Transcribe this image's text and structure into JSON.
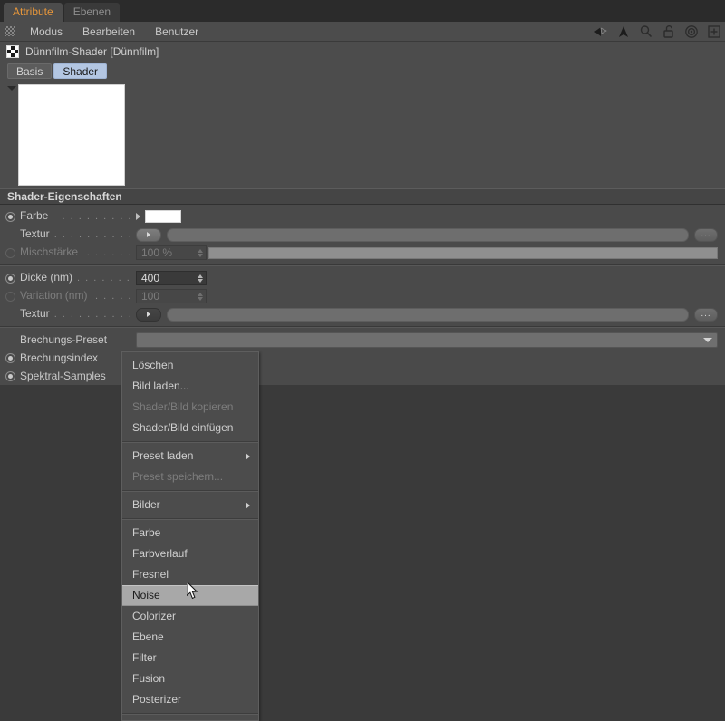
{
  "tabs": [
    {
      "label": "Attribute",
      "active": true
    },
    {
      "label": "Ebenen",
      "active": false
    }
  ],
  "menubar": {
    "grip_icon": "grip-dots-icon",
    "items": [
      "Modus",
      "Bearbeiten",
      "Benutzer"
    ],
    "tool_icons": [
      "back-arrow-icon",
      "up-arrow-icon",
      "search-icon",
      "unlock-icon",
      "target-icon",
      "plus-box-icon"
    ]
  },
  "object": {
    "icon": "checker-shader-icon",
    "title": "Dünnfilm-Shader [Dünnfilm]",
    "subtabs": [
      {
        "label": "Basis",
        "selected": false
      },
      {
        "label": "Shader",
        "selected": true
      }
    ]
  },
  "preview": {
    "collapse_icon": "triangle-down-icon",
    "swatch_color": "#ffffff"
  },
  "section": {
    "title": "Shader-Eigenschaften"
  },
  "properties": [
    {
      "name": "farbe",
      "label": "Farbe",
      "dots": ". . . . . . . . .",
      "radio": "on",
      "control": "color",
      "value": "#ffffff",
      "dim": false
    },
    {
      "name": "textur-farbe",
      "label": "Textur",
      "dots": ". . . . . . . . . . .",
      "radio": "none",
      "control": "texture",
      "value": "",
      "more_label": "...",
      "dim": false
    },
    {
      "name": "mischstaerke",
      "label": "Mischstärke",
      "dots": ". . . . . .",
      "radio": "off",
      "control": "slider",
      "value": "100 %",
      "dim": true
    },
    {
      "name": "dicke",
      "label": "Dicke (nm)",
      "dots": ". . . . . . . .",
      "radio": "on",
      "control": "number",
      "value": "400",
      "dim": false
    },
    {
      "name": "variation",
      "label": "Variation (nm)",
      "dots": ". . . . .",
      "radio": "off",
      "control": "number",
      "value": "100",
      "dim": true
    },
    {
      "name": "textur-dicke",
      "label": "Textur",
      "dots": ". . . . . . . . . . .",
      "radio": "none",
      "control": "texture",
      "value": "",
      "more_label": "...",
      "dim": false
    },
    {
      "name": "brechungs-preset",
      "label": "Brechungs-Preset",
      "dots": "",
      "radio": "none",
      "control": "dropdown",
      "value": "",
      "dim": false
    },
    {
      "name": "brechungsindex",
      "label": "Brechungsindex",
      "dots": "",
      "radio": "on",
      "control": "none",
      "value": "",
      "dim": false
    },
    {
      "name": "spektral-samples",
      "label": "Spektral-Samples",
      "dots": "",
      "radio": "on",
      "control": "none",
      "value": "",
      "dim": false
    }
  ],
  "context_menu": {
    "items": [
      {
        "label": "Löschen",
        "state": "normal",
        "submenu": false
      },
      {
        "label": "Bild laden...",
        "state": "normal",
        "submenu": false
      },
      {
        "label": "Shader/Bild kopieren",
        "state": "disabled",
        "submenu": false
      },
      {
        "label": "Shader/Bild einfügen",
        "state": "normal",
        "submenu": false
      },
      {
        "label": "",
        "state": "separator",
        "submenu": false
      },
      {
        "label": "Preset laden",
        "state": "normal",
        "submenu": true
      },
      {
        "label": "Preset speichern...",
        "state": "disabled",
        "submenu": false
      },
      {
        "label": "",
        "state": "separator",
        "submenu": false
      },
      {
        "label": "Bilder",
        "state": "normal",
        "submenu": true
      },
      {
        "label": "",
        "state": "separator",
        "submenu": false
      },
      {
        "label": "Farbe",
        "state": "normal",
        "submenu": false
      },
      {
        "label": "Farbverlauf",
        "state": "normal",
        "submenu": false
      },
      {
        "label": "Fresnel",
        "state": "normal",
        "submenu": false
      },
      {
        "label": "Noise",
        "state": "highlighted",
        "submenu": false
      },
      {
        "label": "Colorizer",
        "state": "normal",
        "submenu": false
      },
      {
        "label": "Ebene",
        "state": "normal",
        "submenu": false
      },
      {
        "label": "Filter",
        "state": "normal",
        "submenu": false
      },
      {
        "label": "Fusion",
        "state": "normal",
        "submenu": false
      },
      {
        "label": "Posterizer",
        "state": "normal",
        "submenu": false
      }
    ]
  },
  "cursor": {
    "icon": "mouse-pointer-icon"
  },
  "colors": {
    "panel_bg": "#4c4c4c",
    "props_bg": "#4a4a4a",
    "window_bg": "#3a3a3a",
    "accent_tab": "#e8973a",
    "selected_tab": "#b3c6e2",
    "menu_highlight": "#a8a8a8"
  }
}
